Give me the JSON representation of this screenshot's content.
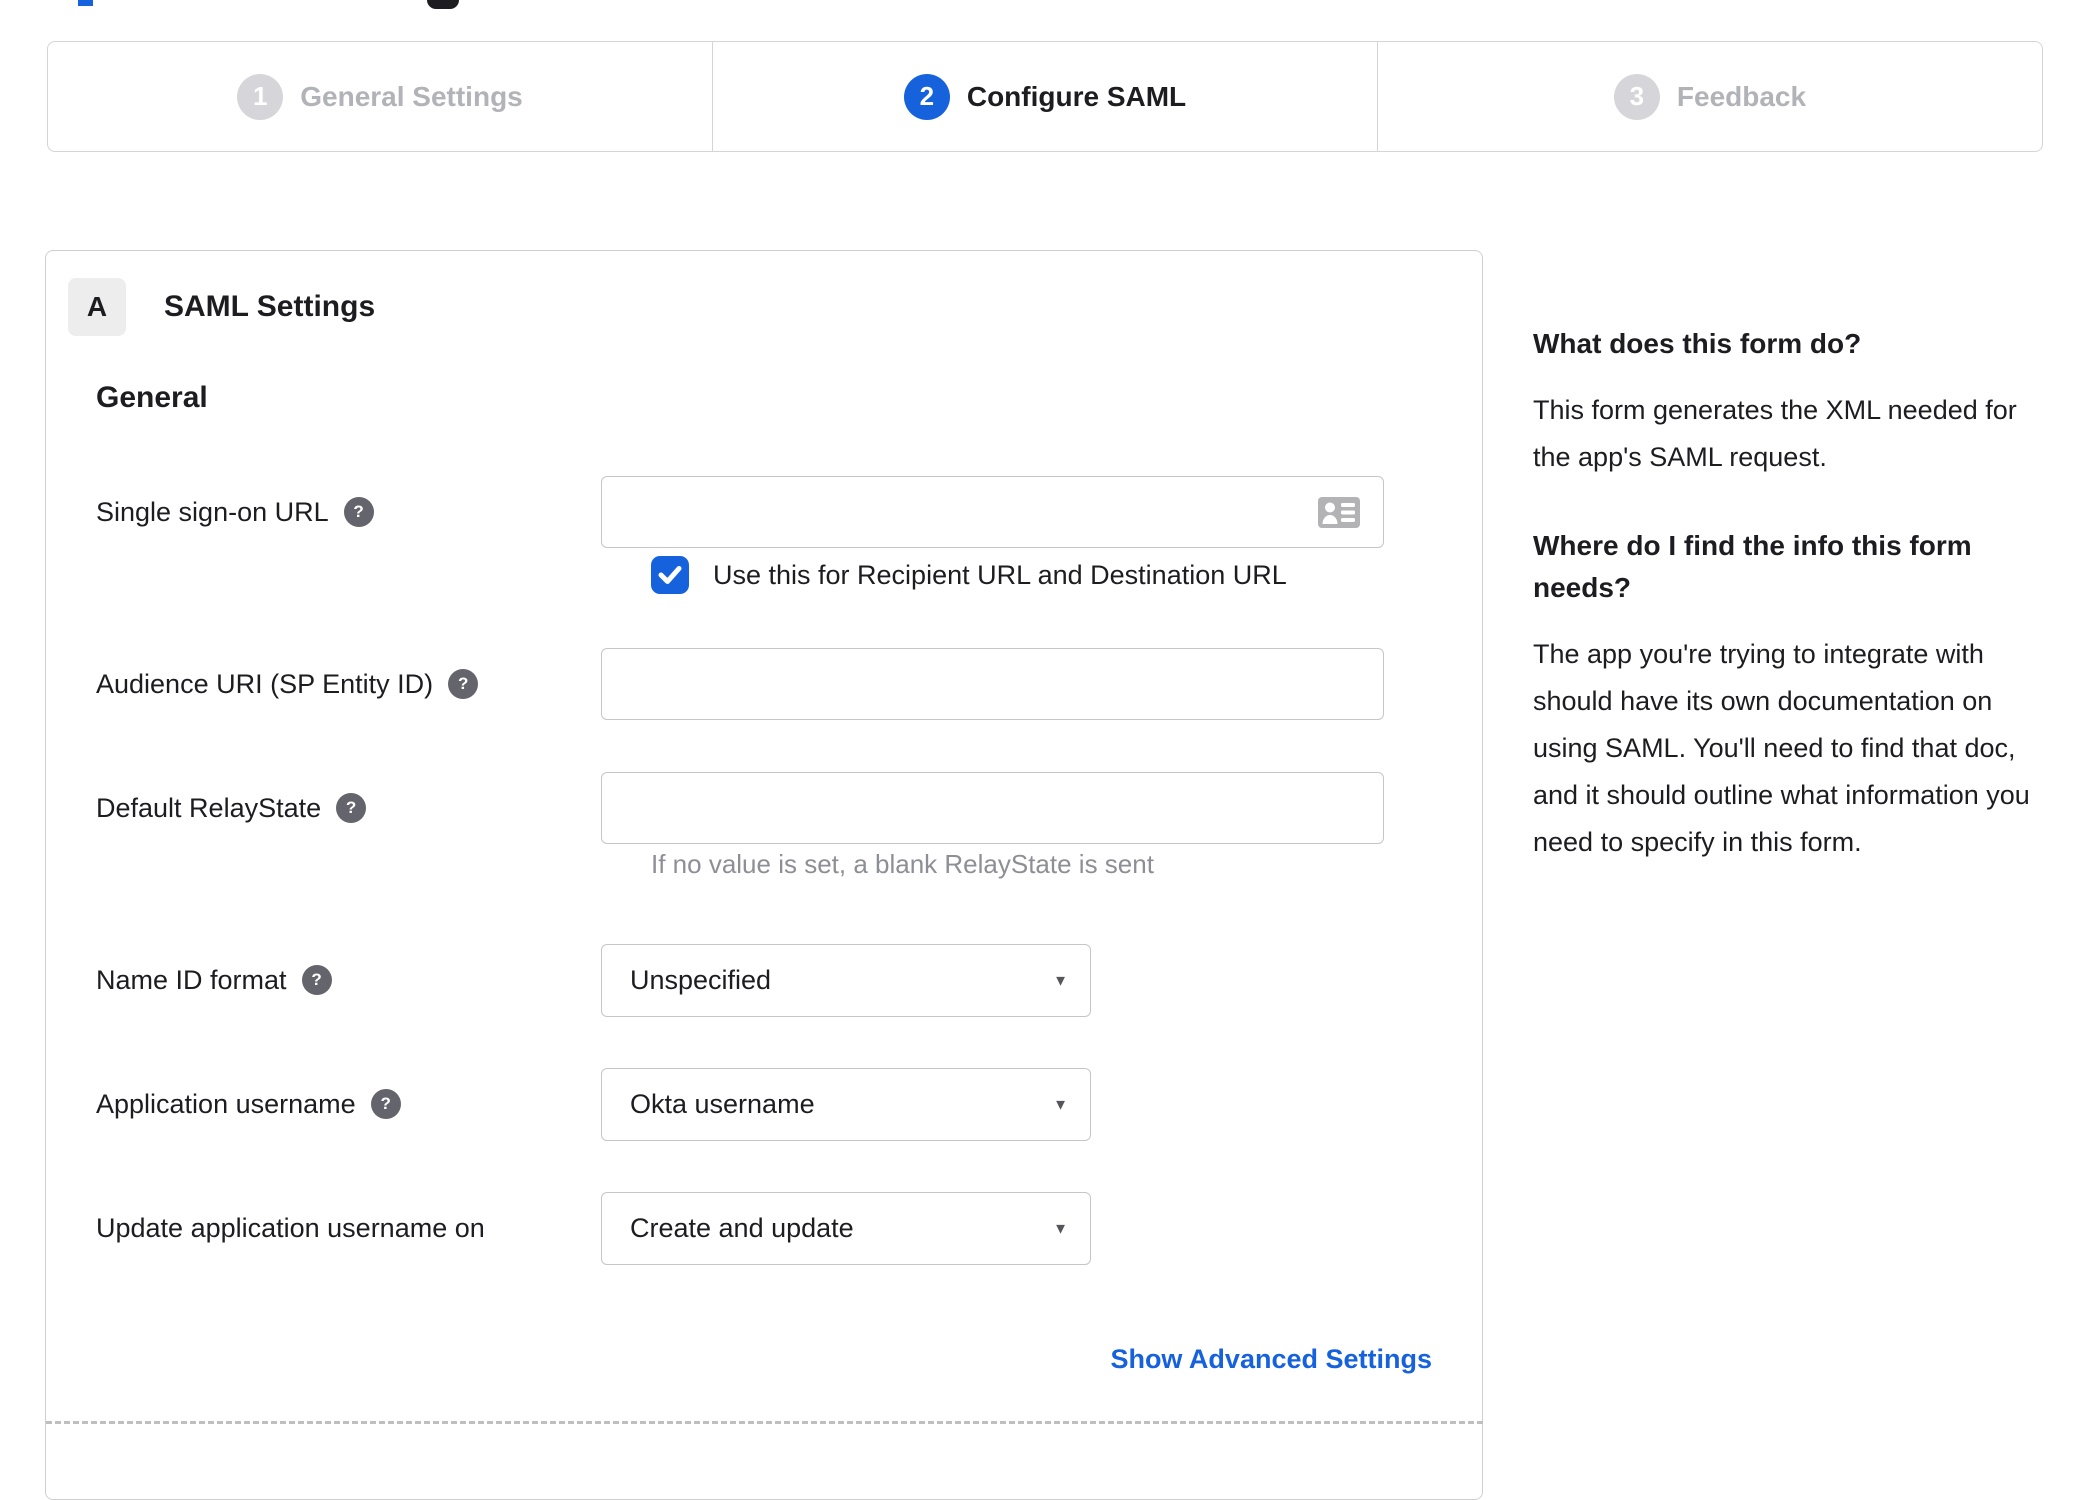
{
  "colors": {
    "accent": "#1662dd",
    "text": "#1d1d21",
    "muted": "#8e8e96"
  },
  "icons": {
    "dropdown_caret": "▼",
    "help_glyph": "?"
  },
  "stepper": {
    "steps": [
      {
        "number": "1",
        "label": "General Settings",
        "state": "inactive"
      },
      {
        "number": "2",
        "label": "Configure SAML",
        "state": "active"
      },
      {
        "number": "3",
        "label": "Feedback",
        "state": "inactive"
      }
    ]
  },
  "panel": {
    "section_badge": "A",
    "section_title": "SAML Settings",
    "group_title": "General",
    "fields": [
      {
        "label": "Single sign-on URL",
        "type": "text",
        "value": "",
        "checkbox": {
          "checked": true,
          "label": "Use this for Recipient URL and Destination URL"
        }
      },
      {
        "label": "Audience URI (SP Entity ID)",
        "type": "text",
        "value": ""
      },
      {
        "label": "Default RelayState",
        "type": "text",
        "value": "",
        "hint": "If no value is set, a blank RelayState is sent"
      },
      {
        "label": "Name ID format",
        "type": "select",
        "value": "Unspecified"
      },
      {
        "label": "Application username",
        "type": "select",
        "value": "Okta username"
      },
      {
        "label": "Update application username on",
        "type": "select",
        "value": "Create and update"
      }
    ],
    "advanced_link": "Show Advanced Settings"
  },
  "sidebar": {
    "sections": [
      {
        "heading": "What does this form do?",
        "body": "This form generates the XML needed for the app's SAML request."
      },
      {
        "heading": "Where do I find the info this form needs?",
        "body": "The app you're trying to integrate with should have its own documentation on using SAML. You'll need to find that doc, and it should outline what information you need to specify in this form."
      }
    ]
  }
}
